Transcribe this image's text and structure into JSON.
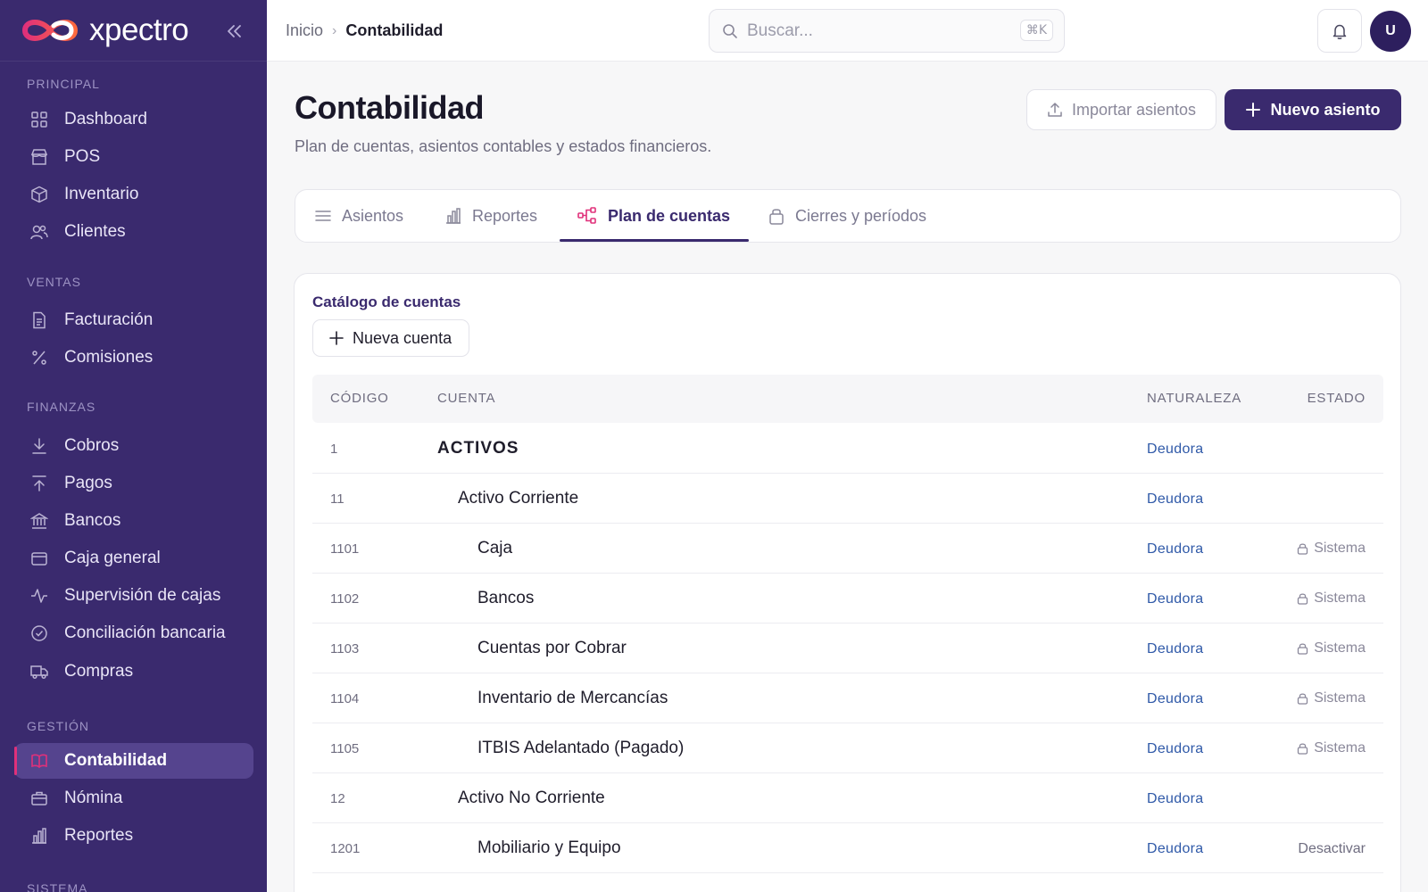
{
  "brand": {
    "name": "xpectro"
  },
  "sidebar": {
    "sections": [
      {
        "label": "PRINCIPAL",
        "items": [
          {
            "label": "Dashboard",
            "icon": "grid-icon"
          },
          {
            "label": "POS",
            "icon": "store-icon"
          },
          {
            "label": "Inventario",
            "icon": "box-icon"
          },
          {
            "label": "Clientes",
            "icon": "users-icon"
          }
        ]
      },
      {
        "label": "VENTAS",
        "items": [
          {
            "label": "Facturación",
            "icon": "document-icon"
          },
          {
            "label": "Comisiones",
            "icon": "percent-icon"
          }
        ]
      },
      {
        "label": "FINANZAS",
        "items": [
          {
            "label": "Cobros",
            "icon": "download-icon"
          },
          {
            "label": "Pagos",
            "icon": "upload-icon"
          },
          {
            "label": "Bancos",
            "icon": "bank-icon"
          },
          {
            "label": "Caja general",
            "icon": "wallet-icon"
          },
          {
            "label": "Supervisión de cajas",
            "icon": "activity-icon"
          },
          {
            "label": "Conciliación bancaria",
            "icon": "check-circle-icon"
          },
          {
            "label": "Compras",
            "icon": "truck-icon"
          }
        ]
      },
      {
        "label": "GESTIÓN",
        "items": [
          {
            "label": "Contabilidad",
            "icon": "book-icon",
            "active": true
          },
          {
            "label": "Nómina",
            "icon": "briefcase-icon"
          },
          {
            "label": "Reportes",
            "icon": "bar-chart-icon"
          }
        ]
      },
      {
        "label": "SISTEMA",
        "items": []
      }
    ]
  },
  "topbar": {
    "breadcrumb": {
      "home": "Inicio",
      "separator": "›",
      "current": "Contabilidad"
    },
    "search": {
      "placeholder": "Buscar...",
      "shortcut": "⌘K"
    },
    "avatar_initial": "U"
  },
  "header": {
    "title": "Contabilidad",
    "subtitle": "Plan de cuentas, asientos contables y estados financieros.",
    "import_label": "Importar asientos",
    "new_label": "Nuevo asiento"
  },
  "tabs": [
    {
      "label": "Asientos",
      "icon": "list-icon"
    },
    {
      "label": "Reportes",
      "icon": "bar-chart-icon"
    },
    {
      "label": "Plan de cuentas",
      "icon": "hierarchy-icon",
      "active": true
    },
    {
      "label": "Cierres y períodos",
      "icon": "lock-icon"
    }
  ],
  "catalog": {
    "title": "Catálogo de cuentas",
    "new_account_label": "Nueva cuenta",
    "columns": {
      "code": "CÓDIGO",
      "account": "CUENTA",
      "nature": "NATURALEZA",
      "status": "ESTADO"
    },
    "rows": [
      {
        "code": "1",
        "name": "ACTIVOS",
        "level": 0,
        "nature": "Deudora",
        "status": ""
      },
      {
        "code": "11",
        "name": "Activo Corriente",
        "level": 1,
        "nature": "Deudora",
        "status": ""
      },
      {
        "code": "1101",
        "name": "Caja",
        "level": 2,
        "nature": "Deudora",
        "status": "Sistema"
      },
      {
        "code": "1102",
        "name": "Bancos",
        "level": 2,
        "nature": "Deudora",
        "status": "Sistema"
      },
      {
        "code": "1103",
        "name": "Cuentas por Cobrar",
        "level": 2,
        "nature": "Deudora",
        "status": "Sistema"
      },
      {
        "code": "1104",
        "name": "Inventario de Mercancías",
        "level": 2,
        "nature": "Deudora",
        "status": "Sistema"
      },
      {
        "code": "1105",
        "name": "ITBIS Adelantado (Pagado)",
        "level": 2,
        "nature": "Deudora",
        "status": "Sistema"
      },
      {
        "code": "12",
        "name": "Activo No Corriente",
        "level": 1,
        "nature": "Deudora",
        "status": ""
      },
      {
        "code": "1201",
        "name": "Mobiliario y Equipo",
        "level": 2,
        "nature": "Deudora",
        "action": "Desactivar"
      }
    ]
  },
  "colors": {
    "brand": "#3a2a6e",
    "accent": "#e0307a",
    "link": "#2f59a8"
  }
}
